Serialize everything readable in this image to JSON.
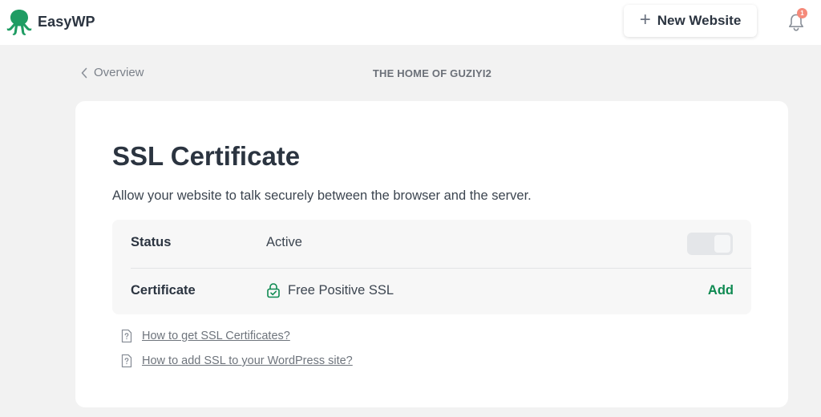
{
  "header": {
    "brand": "EasyWP",
    "new_website_label": "New Website",
    "notification_count": "1"
  },
  "nav": {
    "back_label": "Overview",
    "site_title": "THE HOME OF GUZIYI2"
  },
  "ssl": {
    "title": "SSL Certificate",
    "description": "Allow your website to talk securely between the browser and the server.",
    "rows": [
      {
        "label": "Status",
        "value": "Active",
        "toggle_on": true
      },
      {
        "label": "Certificate",
        "value": "Free Positive SSL",
        "action": "Add"
      }
    ]
  },
  "help_links": [
    "How to get SSL Certificates?",
    "How to add SSL to your WordPress site?"
  ],
  "colors": {
    "brand_green": "#0f8a52",
    "badge": "#f58a7a"
  }
}
